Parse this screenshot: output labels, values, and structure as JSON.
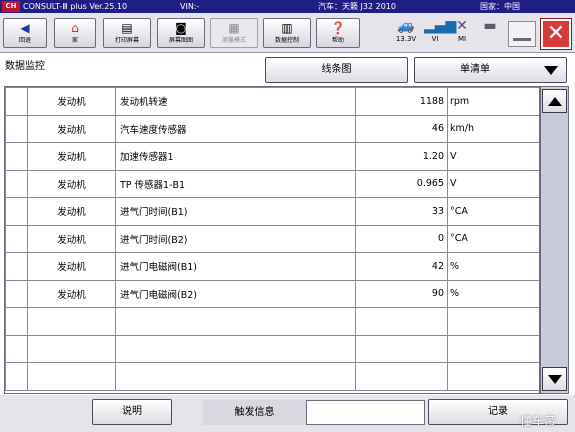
{
  "title_bar": {
    "app_name": "CONSULT-Ⅲ plus Ver.25.10",
    "vin_label": "VIN:-",
    "vehicle": "汽车：天籁 J32 2010",
    "country": "国家：中国"
  },
  "toolbar": {
    "buttons": [
      {
        "label": "回退",
        "icon": "back-arrow-icon"
      },
      {
        "label": "家",
        "icon": "home-icon"
      },
      {
        "label": "打印屏幕",
        "icon": "print-icon"
      },
      {
        "label": "屏幕图图",
        "icon": "camera-icon"
      },
      {
        "label": "测量模式",
        "icon": "measure-icon",
        "disabled": true
      },
      {
        "label": "数据控制",
        "icon": "data-control-icon"
      },
      {
        "label": "帮助",
        "icon": "help-icon"
      }
    ],
    "status": {
      "battery_voltage": "13.3V",
      "vi_label": "VI",
      "mi_label": "MI"
    }
  },
  "header": {
    "section_title": "数据监控",
    "graph_button": "线条图",
    "list_mode": "单清单"
  },
  "table": {
    "rows": [
      {
        "system": "发动机",
        "item": "发动机转速",
        "value": "1188",
        "unit": "rpm"
      },
      {
        "system": "发动机",
        "item": "汽车速度传感器",
        "value": "46",
        "unit": "km/h"
      },
      {
        "system": "发动机",
        "item": "加速传感器1",
        "value": "1.20",
        "unit": "V"
      },
      {
        "system": "发动机",
        "item": "TP 传感器1-B1",
        "value": "0.965",
        "unit": "V"
      },
      {
        "system": "发动机",
        "item": "进气门时间(B1)",
        "value": "33",
        "unit": "°CA"
      },
      {
        "system": "发动机",
        "item": "进气门时间(B2)",
        "value": "0",
        "unit": "°CA"
      },
      {
        "system": "发动机",
        "item": "进气门电磁阀(B1)",
        "value": "42",
        "unit": "%"
      },
      {
        "system": "发动机",
        "item": "进气门电磁阀(B2)",
        "value": "90",
        "unit": "%"
      },
      {
        "system": "",
        "item": "",
        "value": "",
        "unit": ""
      },
      {
        "system": "",
        "item": "",
        "value": "",
        "unit": ""
      },
      {
        "system": "",
        "item": "",
        "value": "",
        "unit": ""
      }
    ]
  },
  "bottom": {
    "explain_button": "说明",
    "trigger_label": "触发信息",
    "record_button": "记录",
    "watermark": "懂车帝"
  },
  "colors": {
    "title_bar": "#1e1e84",
    "close_button": "#d83a3a",
    "scrollbar_track": "#c8ccda"
  }
}
